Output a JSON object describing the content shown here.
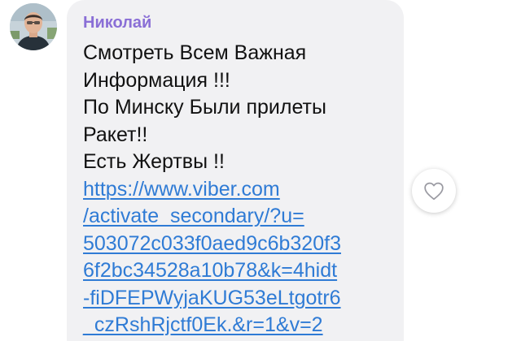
{
  "message": {
    "sender": "Николай",
    "text_lines": [
      "Смотреть Всем Важная",
      "Информация !!!",
      "По Минску Были прилеты",
      "Ракет!!",
      "Есть Жертвы !!"
    ],
    "link_lines": [
      "https://www.viber.com",
      "/activate_secondary/?u=",
      "503072c033f0aed9c6b320f3",
      "6f2bc34528a10b78&k=4hidt",
      "-fiDFEPWyjaKUG53eLtgotr6",
      "_czRshRjctf0Ek.&r=1&v=2"
    ]
  },
  "icons": {
    "avatar": "user-photo",
    "like": "heart-outline-icon"
  },
  "colors": {
    "bubble": "#f1f1f3",
    "sender": "#8a6fd6",
    "link": "#2f7bd5",
    "text": "#111111"
  }
}
